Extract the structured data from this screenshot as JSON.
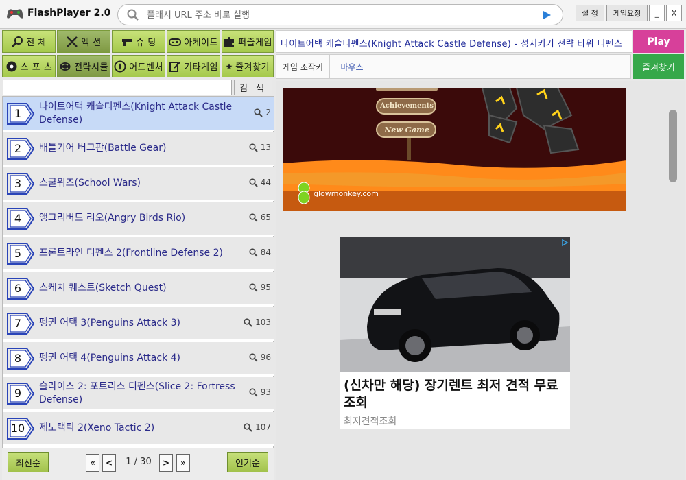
{
  "app": {
    "title": "FlashPlayer 2.0"
  },
  "urlbar": {
    "placeholder": "플래시 URL 주소 바로 실행"
  },
  "window_buttons": {
    "settings": "설 정",
    "request": "게임요청",
    "minimize": "_",
    "close": "X"
  },
  "categories": [
    {
      "label": "전 체",
      "icon": "magnifier-icon"
    },
    {
      "label": "액 션",
      "icon": "crossed-swords-icon",
      "active": true
    },
    {
      "label": "슈 팅",
      "icon": "gun-icon"
    },
    {
      "label": "아케이드",
      "icon": "gamepad-icon"
    },
    {
      "label": "퍼즐게임",
      "icon": "puzzle-icon"
    },
    {
      "label": "스 포 츠",
      "icon": "soccer-ball-icon"
    },
    {
      "label": "전략시뮬",
      "icon": "brain-icon",
      "active": true
    },
    {
      "label": "어드벤처",
      "icon": "compass-icon"
    },
    {
      "label": "기타게임",
      "icon": "edit-icon"
    },
    {
      "label": "즐겨찾기",
      "icon": "star-icon"
    }
  ],
  "search": {
    "button": "검 색",
    "value": ""
  },
  "games": [
    {
      "num": "1",
      "title": "나이트어택 캐슬디펜스(Knight Attack Castle Defense)",
      "count": "2",
      "selected": true
    },
    {
      "num": "2",
      "title": "배틀기어 버그판(Battle Gear)",
      "count": "13"
    },
    {
      "num": "3",
      "title": "스쿨워즈(School Wars)",
      "count": "44"
    },
    {
      "num": "4",
      "title": "앵그리버드 리오(Angry Birds Rio)",
      "count": "65"
    },
    {
      "num": "5",
      "title": "프론트라인 디펜스 2(Frontline Defense 2)",
      "count": "84"
    },
    {
      "num": "6",
      "title": "스케치 퀘스트(Sketch Quest)",
      "count": "95"
    },
    {
      "num": "7",
      "title": "펭귄 어택 3(Penguins Attack 3)",
      "count": "103"
    },
    {
      "num": "8",
      "title": "펭귄 어택 4(Penguins Attack 4)",
      "count": "96"
    },
    {
      "num": "9",
      "title": "슬라이스 2: 포트리스 디펜스(Slice 2: Fortress Defense)",
      "count": "93"
    },
    {
      "num": "10",
      "title": "제노택틱 2(Xeno Tactic 2)",
      "count": "107"
    }
  ],
  "pager": {
    "newest": "최신순",
    "popular": "인기순",
    "first": "«",
    "prev": "<",
    "next": ">",
    "last": "»",
    "page_info": "1 / 30"
  },
  "game_header": {
    "title": "나이트어택 캐슬디펜스(Knight Attack Castle Defense) - 성지키기 전략 타워 디펜스",
    "play": "Play",
    "favorite": "즐겨찾기"
  },
  "tabs": {
    "controls": "게임 조작키",
    "mouse": "마우스"
  },
  "game_frame": {
    "menu1": "Achievements",
    "menu2": "New Game",
    "logo": "glowmonkey.com"
  },
  "ad": {
    "headline": "(신차만 해당) 장기렌트 최저 견적 무료 조회",
    "source": "최저견적조회"
  },
  "colors": {
    "category_green": "#a5c94c",
    "play_pink": "#d7409a",
    "favorite_green": "#36a84a",
    "selected_row": "#c7daf7",
    "title_blue": "#1f2a9a"
  }
}
